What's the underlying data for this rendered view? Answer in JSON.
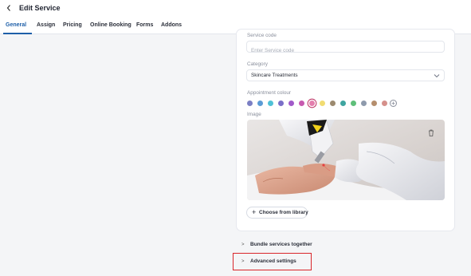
{
  "header": {
    "back_icon": "chevron-left-icon",
    "title": "Edit Service"
  },
  "tabs": [
    "General",
    "Assign",
    "Pricing",
    "Online Booking",
    "Forms",
    "Addons"
  ],
  "active_tab": "General",
  "form": {
    "service_code": {
      "label": "Service code",
      "placeholder": "Enter Service code",
      "value": ""
    },
    "category": {
      "label": "Category",
      "value": "Skincare Treatments"
    },
    "appointment_colour": {
      "label": "Appointment colour",
      "colors": [
        "#7b7fc4",
        "#5b9bd5",
        "#4fc1d6",
        "#7a6fc8",
        "#a15ac9",
        "#c75ab0",
        "#e47fae",
        "#f1dc72",
        "#9c8a6f",
        "#3fa5a0",
        "#5fbf7a",
        "#8e9aac",
        "#b58e6d",
        "#d5908b"
      ],
      "selected_index": 6
    },
    "image": {
      "label": "Image"
    },
    "library_button": "Choose from library"
  },
  "sections": {
    "bundle": "Bundle services together",
    "advanced": "Advanced settings"
  },
  "accent_color": "#1e5fa8",
  "highlight_color": "#d9252a"
}
